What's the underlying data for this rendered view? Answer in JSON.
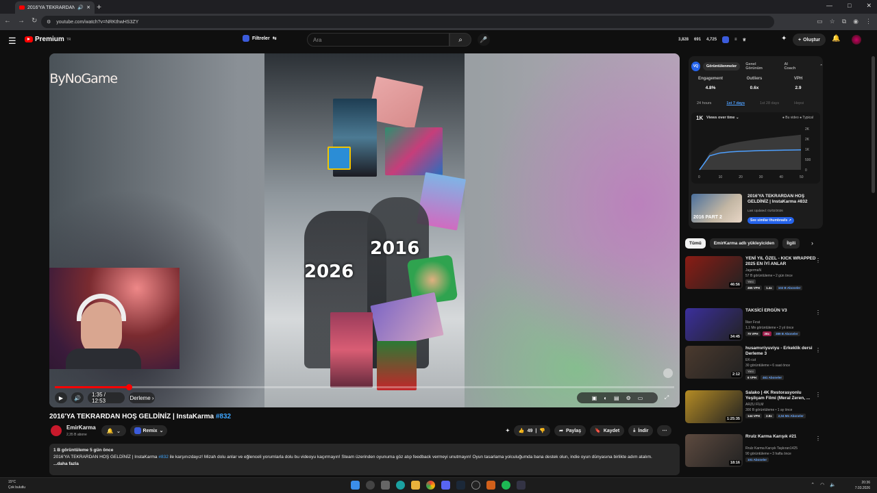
{
  "browser": {
    "tab_title": "2016'YA TEKRARDAN HOŞ",
    "new_tab": "+",
    "url": "youtube.com/watch?v=NRKthwHS3ZY",
    "window_controls": [
      "—",
      "□",
      "✕"
    ]
  },
  "header": {
    "logo": "Premium",
    "logo_region": "TR",
    "filters_label": "Filtreler",
    "search_placeholder": "Ara",
    "stats": [
      "3,828",
      "691",
      "4,725"
    ],
    "create_label": "Oluştur"
  },
  "player": {
    "brand": "ByNoGame",
    "year_a": "2016",
    "year_b": "2026",
    "time": "1:35 / 12:53",
    "chapter": "Derleme",
    "progress_fraction": 0.12
  },
  "video": {
    "title": "2016'YA TEKRARDAN HOŞ GELDİNİZ | InstaKarma",
    "title_tag": "#832",
    "channel": "EmirKarma",
    "subscribers": "2,35 B abone",
    "remix_label": "Remix",
    "likes": "49",
    "share_label": "Paylaş",
    "save_label": "Kaydet",
    "download_label": "İndir"
  },
  "description": {
    "meta": "1 B görüntüleme  5 gün önce",
    "text_pre": "2016'YA TEKRARDAN HOŞ GELDİNİZ | InstaKarma",
    "hash": "#832",
    "text_post": "ile karşınızdayız!  Mizah dolu anlar ve eğlenceli yorumlarla dolu bu videoyu kaçırmayın! Steam üzerinden oyunuma göz atıp feedback vermeyi unutmayın! Oyun tasarlama yolculuğumda bana destek olun, indie oyun dünyasına birlikte adım atalım.",
    "more": "...daha fazla"
  },
  "analytics": {
    "tabs": [
      "Görüntülenmeler",
      "Genel Görünüm",
      "AI Coach"
    ],
    "logo": "VQ",
    "metrics": [
      {
        "label": "Engagement",
        "value": "4.8%"
      },
      {
        "label": "Outliers",
        "value": "0.6x"
      },
      {
        "label": "VPH",
        "value": "2.9"
      }
    ],
    "ranges": [
      "24 hours",
      "1st 7 days",
      "1st 28 days",
      "Hepsi"
    ],
    "chart_title": "1K",
    "chart_selector": "Views over time ⌄",
    "chart_legend": "● Bu video  ● Typical",
    "similar_title": "2016'YA TEKRARDAN HOŞ GELDİNİZ | InstaKarma #832",
    "similar_updated": "Last Updated: 01/02/2026",
    "similar_button": "See similar thumbnails  ↗",
    "similar_thumb_text": "2016 PART 2"
  },
  "chart_data": {
    "type": "area",
    "x": [
      0,
      5,
      10,
      15,
      20,
      25,
      30,
      35,
      40,
      45,
      50
    ],
    "series": [
      {
        "name": "Bu video",
        "values": [
          0,
          750,
          900,
          960,
          990,
          1010,
          1030,
          1040,
          1050,
          1060,
          1070
        ]
      },
      {
        "name": "Typical",
        "values": [
          0,
          900,
          1250,
          1400,
          1500,
          1580,
          1650,
          1710,
          1770,
          1820,
          1880
        ]
      }
    ],
    "x_ticks": [
      "0",
      "10",
      "20",
      "30",
      "40",
      "50"
    ],
    "y_ticks": [
      "0",
      "500",
      "1K",
      "2K",
      "2K"
    ],
    "ylim": [
      0,
      2200
    ],
    "xlim": [
      0,
      50
    ]
  },
  "chips": [
    "Tümü",
    "EmirKarma adlı yükleyiciden",
    "İlgili"
  ],
  "recommendations": [
    {
      "title": "YENİ YIL ÖZEL - KICK WRAPPED 2025 EN İYİ ANLAR",
      "channel": "JagermaN",
      "meta": "57 B görüntüleme • 2 gün önce",
      "badge": "Yeni",
      "duration": "46:56",
      "pills": [
        "465 VPH",
        "1.4x",
        "102 B Aboneler"
      ],
      "color": "#8b1c14"
    },
    {
      "title": "TAKSİCİ ERGÜN V3",
      "channel": "İlker Fırat",
      "meta": "1,1 Mn görüntüleme • 2 yıl önce",
      "badge": "",
      "duration": "34:45",
      "pills": [
        "70 VPH",
        "28x",
        "389 B Aboneler"
      ],
      "color": "#3b2f9c"
    },
    {
      "title": "husamvriyuviyu - Erkeklik dersi Derleme 3",
      "channel": "EK-cut",
      "meta": "30 görüntüleme • 6 saat önce",
      "badge": "Yeni",
      "duration": "2:12",
      "pills": [
        "6 VPH",
        "461 Aboneler"
      ],
      "color": "#4b3a2e"
    },
    {
      "title": "Salako | 4K Restorasyonlu Yeşilçam Filmi (Meral Zeren, ...",
      "channel": "ARZU FİLM",
      "meta": "300 B görüntüleme • 1 ay önce",
      "badge": "",
      "duration": "1:25:35",
      "pills": [
        "144 VPH",
        "2.8x",
        "2,04 Mn Aboneler"
      ],
      "color": "#b48b24"
    },
    {
      "title": "Rrulz Karma Karışık #21",
      "channel": "Rrulz Karma Karışık Taşkıran1425",
      "meta": "90 görüntüleme • 3 hafta önce",
      "badge": "",
      "duration": "18:16",
      "pills": [
        "101 Aboneler"
      ],
      "color": "#5d4a3f"
    }
  ],
  "taskbar": {
    "weather_temp": "15°C",
    "weather_desc": "Çok bulutlu",
    "time": "20:36",
    "date": "7.03.2026"
  }
}
